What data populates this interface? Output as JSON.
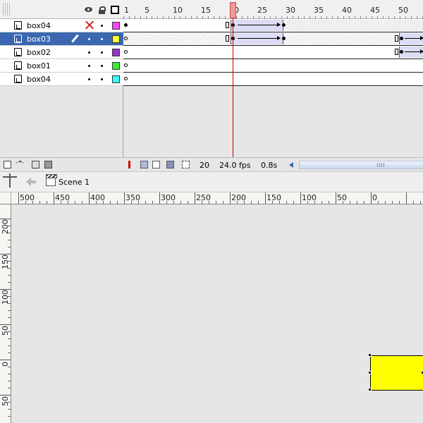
{
  "timeline": {
    "frame_numbers": [
      "1",
      "5",
      "10",
      "15",
      "20",
      "25",
      "30",
      "35",
      "40",
      "45",
      "50"
    ],
    "layers": [
      {
        "name": "box04",
        "color": "#ff44ff",
        "hidden": true,
        "selected": false
      },
      {
        "name": "box03",
        "color": "#ffff33",
        "hidden": false,
        "selected": true
      },
      {
        "name": "box02",
        "color": "#9933cc",
        "hidden": false,
        "selected": false
      },
      {
        "name": "box01",
        "color": "#33ee33",
        "hidden": false,
        "selected": false
      },
      {
        "name": "box04",
        "color": "#33ffff",
        "hidden": false,
        "selected": false
      }
    ],
    "status": {
      "current_frame": "20",
      "fps": "24.0 fps",
      "elapsed": "0.8s"
    }
  },
  "edit_bar": {
    "scene_label": "Scene 1"
  },
  "rulers": {
    "horizontal_labels": [
      "500",
      "450",
      "400",
      "350",
      "300",
      "250",
      "200",
      "150",
      "100",
      "50",
      "0"
    ],
    "vertical_labels": [
      "200",
      "150",
      "100",
      "50",
      "0",
      "50"
    ]
  },
  "stage": {
    "shape_fill": "#ffff00"
  }
}
